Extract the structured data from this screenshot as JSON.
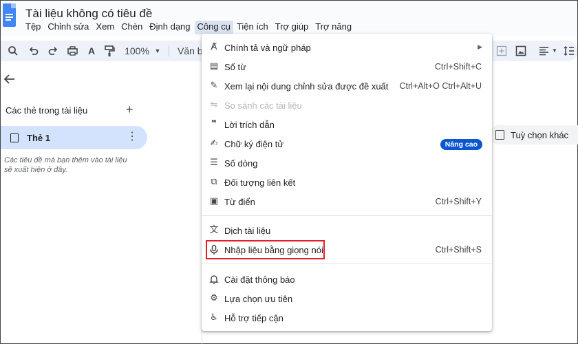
{
  "app": {
    "doc_title": "Tài liệu không có tiêu đề",
    "brand_color": "#4285f4"
  },
  "menubar": [
    "Tệp",
    "Chỉnh sửa",
    "Xem",
    "Chèn",
    "Định dạng",
    "Công cụ",
    "Tiện ích",
    "Trợ giúp",
    "Trợ năng"
  ],
  "toolbar": {
    "zoom": "100%",
    "style": "Văn b"
  },
  "sidebar": {
    "heading": "Các thẻ trong tài liệu",
    "tab_label": "Thẻ 1",
    "hint_line1": "Các tiêu đề mà bạn thêm vào tài liệu",
    "hint_line2": "sẽ xuất hiện ở đây."
  },
  "options_button": "Tuỳ chọn khác",
  "tools_menu": {
    "items": [
      {
        "label": "Chính tả và ngữ pháp",
        "icon": "spellcheck-icon"
      },
      {
        "label": "Số từ",
        "shortcut": "Ctrl+Shift+C",
        "icon": "word-count-icon"
      },
      {
        "label": "Xem lại nội dung chỉnh sửa được đề xuất",
        "shortcut": "Ctrl+Alt+O Ctrl+Alt+U",
        "icon": "review-edits-icon"
      },
      {
        "label": "So sánh các tài liệu",
        "icon": "compare-icon",
        "disabled": true
      },
      {
        "label": "Lời trích dẫn",
        "icon": "citation-icon"
      },
      {
        "label": "Chữ ký điện tử",
        "badge": "Nâng cao",
        "icon": "signature-icon"
      },
      {
        "label": "Số dòng",
        "icon": "line-numbers-icon"
      },
      {
        "label": "Đối tượng liên kết",
        "icon": "linked-objects-icon"
      },
      {
        "label": "Từ điển",
        "shortcut": "Ctrl+Shift+Y",
        "icon": "dictionary-icon"
      },
      {
        "label": "Dịch tài liệu",
        "icon": "translate-icon"
      },
      {
        "label": "Nhập liệu bằng giọng nói",
        "shortcut": "Ctrl+Shift+S",
        "icon": "microphone-icon"
      },
      {
        "label": "Cài đặt thông báo",
        "icon": "bell-icon"
      },
      {
        "label": "Lựa chọn ưu tiên",
        "icon": "preferences-icon"
      },
      {
        "label": "Hỗ trợ tiếp cận",
        "icon": "accessibility-icon"
      }
    ]
  },
  "highlight_color": "#e21f26"
}
